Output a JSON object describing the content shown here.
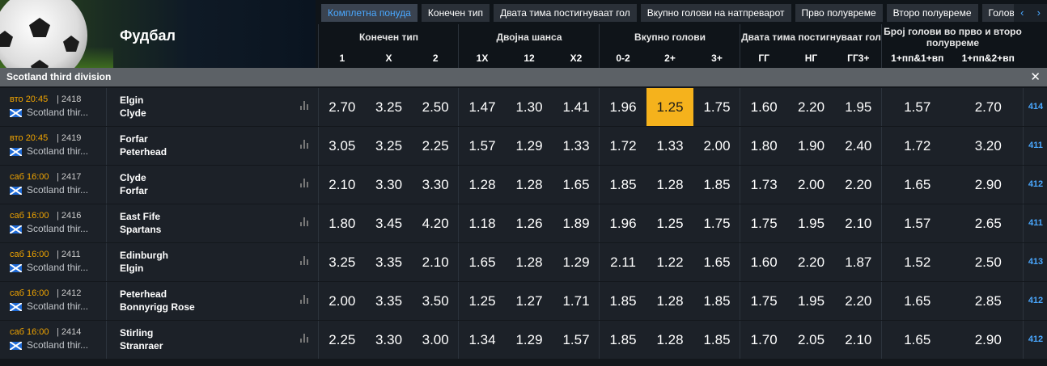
{
  "header": {
    "sport": "Фудбал"
  },
  "tabs": [
    {
      "label": "Комплетна понуда",
      "active": true
    },
    {
      "label": "Конечен тип",
      "active": false
    },
    {
      "label": "Двата тима постигнуваат гол",
      "active": false
    },
    {
      "label": "Вкупно голови на натпреварот",
      "active": false
    },
    {
      "label": "Прво полувреме",
      "active": false
    },
    {
      "label": "Второ полувреме",
      "active": false
    },
    {
      "label": "Голови",
      "active": false
    }
  ],
  "tab_nav": {
    "prev": "‹",
    "next": "›"
  },
  "markets": [
    {
      "title": "Конечен тип",
      "cols": [
        "1",
        "X",
        "2"
      ]
    },
    {
      "title": "Двојна шанса",
      "cols": [
        "1X",
        "12",
        "X2"
      ]
    },
    {
      "title": "Вкупно голови",
      "cols": [
        "0-2",
        "2+",
        "3+"
      ]
    },
    {
      "title": "Двата тима постигнуваат гол",
      "cols": [
        "ГГ",
        "НГ",
        "ГГ3+"
      ]
    },
    {
      "title": "Број голови во прво и второ полувреме",
      "cols": [
        "1+пп&1+вп",
        "1+пп&2+вп"
      ]
    }
  ],
  "league": {
    "name": "Scotland third division",
    "close": "✕"
  },
  "matches": [
    {
      "time": "вто 20:45",
      "code": "| 2418",
      "league": "Scotland thir...",
      "home": "Elgin",
      "away": "Clyde",
      "odds": [
        "2.70",
        "3.25",
        "2.50",
        "1.47",
        "1.30",
        "1.41",
        "1.96",
        "1.25",
        "1.75",
        "1.60",
        "2.20",
        "1.95",
        "1.57",
        "2.70"
      ],
      "more": "414",
      "highlight": 7
    },
    {
      "time": "вто 20:45",
      "code": "| 2419",
      "league": "Scotland thir...",
      "home": "Forfar",
      "away": "Peterhead",
      "odds": [
        "3.05",
        "3.25",
        "2.25",
        "1.57",
        "1.29",
        "1.33",
        "1.72",
        "1.33",
        "2.00",
        "1.80",
        "1.90",
        "2.40",
        "1.72",
        "3.20"
      ],
      "more": "411"
    },
    {
      "time": "саб 16:00",
      "code": "| 2417",
      "league": "Scotland thir...",
      "home": "Clyde",
      "away": "Forfar",
      "odds": [
        "2.10",
        "3.30",
        "3.30",
        "1.28",
        "1.28",
        "1.65",
        "1.85",
        "1.28",
        "1.85",
        "1.73",
        "2.00",
        "2.20",
        "1.65",
        "2.90"
      ],
      "more": "412"
    },
    {
      "time": "саб 16:00",
      "code": "| 2416",
      "league": "Scotland thir...",
      "home": "East Fife",
      "away": "Spartans",
      "odds": [
        "1.80",
        "3.45",
        "4.20",
        "1.18",
        "1.26",
        "1.89",
        "1.96",
        "1.25",
        "1.75",
        "1.75",
        "1.95",
        "2.10",
        "1.57",
        "2.65"
      ],
      "more": "411"
    },
    {
      "time": "саб 16:00",
      "code": "| 2411",
      "league": "Scotland thir...",
      "home": "Edinburgh",
      "away": "Elgin",
      "odds": [
        "3.25",
        "3.35",
        "2.10",
        "1.65",
        "1.28",
        "1.29",
        "2.11",
        "1.22",
        "1.65",
        "1.60",
        "2.20",
        "1.87",
        "1.52",
        "2.50"
      ],
      "more": "413"
    },
    {
      "time": "саб 16:00",
      "code": "| 2412",
      "league": "Scotland thir...",
      "home": "Peterhead",
      "away": "Bonnyrigg Rose",
      "odds": [
        "2.00",
        "3.35",
        "3.50",
        "1.25",
        "1.27",
        "1.71",
        "1.85",
        "1.28",
        "1.85",
        "1.75",
        "1.95",
        "2.20",
        "1.65",
        "2.85"
      ],
      "more": "412"
    },
    {
      "time": "саб 16:00",
      "code": "| 2414",
      "league": "Scotland thir...",
      "home": "Stirling",
      "away": "Stranraer",
      "odds": [
        "2.25",
        "3.30",
        "3.00",
        "1.34",
        "1.29",
        "1.57",
        "1.85",
        "1.28",
        "1.85",
        "1.70",
        "2.05",
        "2.10",
        "1.65",
        "2.90"
      ],
      "more": "412"
    }
  ],
  "colors": {
    "accent": "#4aa8ff",
    "time": "#f0a400",
    "highlight": "#f5b21c",
    "row_bg": "#1c2128",
    "league_bar": "#5c6166"
  },
  "icons": {
    "stats": "bar-chart-icon",
    "flag": "scotland-flag-icon",
    "ball": "football-icon"
  }
}
